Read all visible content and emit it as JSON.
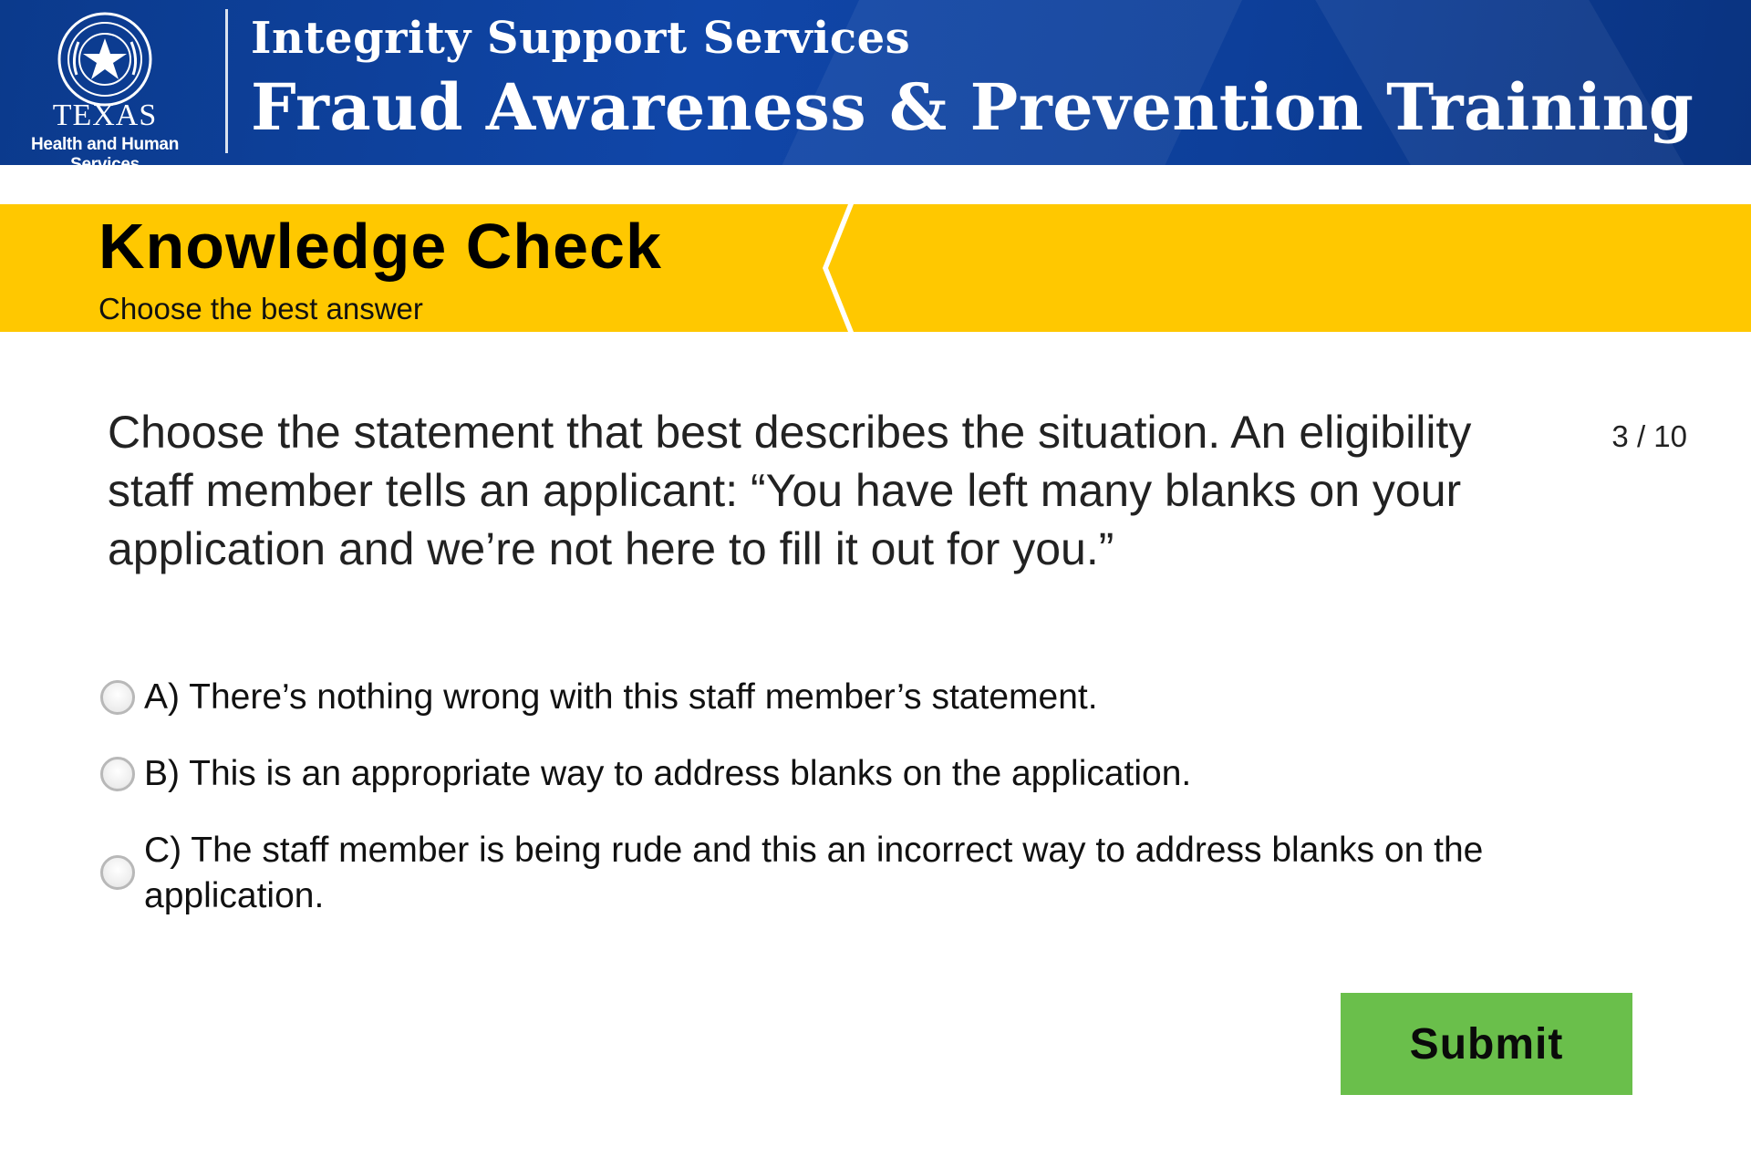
{
  "header": {
    "logo_line1": "TEXAS",
    "logo_line2": "Health and Human Services",
    "subtitle": "Integrity Support Services",
    "title": "Fraud Awareness & Prevention Training",
    "colors": {
      "banner": "#0d3f9a",
      "text": "#ffffff"
    }
  },
  "knowledge_check": {
    "title": "Knowledge Check",
    "instruction": "Choose the best answer",
    "band_color": "#ffc800"
  },
  "question": {
    "text": "Choose the statement that best describes the situation. An eligibility staff member tells an applicant: “You have left many blanks on your application and we’re not here to fill it out for you.”",
    "counter": "3 / 10"
  },
  "options": [
    {
      "label": "A) There’s nothing wrong with this staff member’s statement.",
      "selected": false
    },
    {
      "label": "B) This is an appropriate way to address blanks on the application.",
      "selected": false
    },
    {
      "label": "C) The staff member is being rude and this an incorrect way to address blanks on the application.",
      "selected": false
    }
  ],
  "submit": {
    "label": "Submit",
    "color": "#6abf4b"
  }
}
